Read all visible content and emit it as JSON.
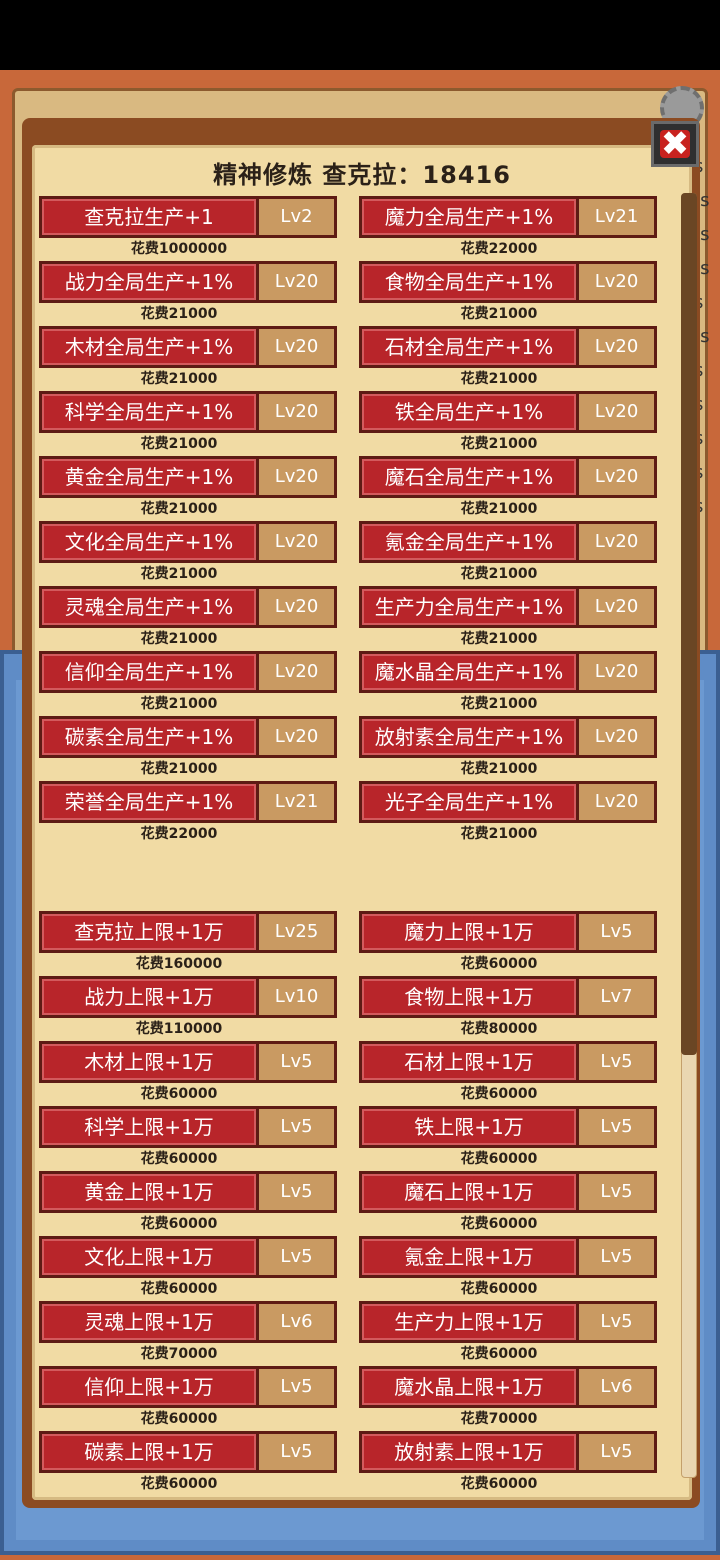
{
  "title": "精神修炼  查克拉：18416",
  "close_label": "✖",
  "side_texts": [
    "s",
    "/s",
    "/s",
    "/s",
    "s",
    "/s",
    "s",
    "s",
    "s",
    "s",
    "s"
  ],
  "global_items": [
    {
      "label": "查克拉生产+1",
      "level": "Lv2",
      "cost": "花费1000000"
    },
    {
      "label": "魔力全局生产+1%",
      "level": "Lv21",
      "cost": "花费22000"
    },
    {
      "label": "战力全局生产+1%",
      "level": "Lv20",
      "cost": "花费21000"
    },
    {
      "label": "食物全局生产+1%",
      "level": "Lv20",
      "cost": "花费21000"
    },
    {
      "label": "木材全局生产+1%",
      "level": "Lv20",
      "cost": "花费21000"
    },
    {
      "label": "石材全局生产+1%",
      "level": "Lv20",
      "cost": "花费21000"
    },
    {
      "label": "科学全局生产+1%",
      "level": "Lv20",
      "cost": "花费21000"
    },
    {
      "label": "铁全局生产+1%",
      "level": "Lv20",
      "cost": "花费21000"
    },
    {
      "label": "黄金全局生产+1%",
      "level": "Lv20",
      "cost": "花费21000"
    },
    {
      "label": "魔石全局生产+1%",
      "level": "Lv20",
      "cost": "花费21000"
    },
    {
      "label": "文化全局生产+1%",
      "level": "Lv20",
      "cost": "花费21000"
    },
    {
      "label": "氪金全局生产+1%",
      "level": "Lv20",
      "cost": "花费21000"
    },
    {
      "label": "灵魂全局生产+1%",
      "level": "Lv20",
      "cost": "花费21000"
    },
    {
      "label": "生产力全局生产+1%",
      "level": "Lv20",
      "cost": "花费21000"
    },
    {
      "label": "信仰全局生产+1%",
      "level": "Lv20",
      "cost": "花费21000"
    },
    {
      "label": "魔水晶全局生产+1%",
      "level": "Lv20",
      "cost": "花费21000"
    },
    {
      "label": "碳素全局生产+1%",
      "level": "Lv20",
      "cost": "花费21000"
    },
    {
      "label": "放射素全局生产+1%",
      "level": "Lv20",
      "cost": "花费21000"
    },
    {
      "label": "荣誉全局生产+1%",
      "level": "Lv21",
      "cost": "花费22000"
    },
    {
      "label": "光子全局生产+1%",
      "level": "Lv20",
      "cost": "花费21000"
    }
  ],
  "limit_items": [
    {
      "label": "查克拉上限+1万",
      "level": "Lv25",
      "cost": "花费160000"
    },
    {
      "label": "魔力上限+1万",
      "level": "Lv5",
      "cost": "花费60000"
    },
    {
      "label": "战力上限+1万",
      "level": "Lv10",
      "cost": "花费110000"
    },
    {
      "label": "食物上限+1万",
      "level": "Lv7",
      "cost": "花费80000"
    },
    {
      "label": "木材上限+1万",
      "level": "Lv5",
      "cost": "花费60000"
    },
    {
      "label": "石材上限+1万",
      "level": "Lv5",
      "cost": "花费60000"
    },
    {
      "label": "科学上限+1万",
      "level": "Lv5",
      "cost": "花费60000"
    },
    {
      "label": "铁上限+1万",
      "level": "Lv5",
      "cost": "花费60000"
    },
    {
      "label": "黄金上限+1万",
      "level": "Lv5",
      "cost": "花费60000"
    },
    {
      "label": "魔石上限+1万",
      "level": "Lv5",
      "cost": "花费60000"
    },
    {
      "label": "文化上限+1万",
      "level": "Lv5",
      "cost": "花费60000"
    },
    {
      "label": "氪金上限+1万",
      "level": "Lv5",
      "cost": "花费60000"
    },
    {
      "label": "灵魂上限+1万",
      "level": "Lv6",
      "cost": "花费70000"
    },
    {
      "label": "生产力上限+1万",
      "level": "Lv5",
      "cost": "花费60000"
    },
    {
      "label": "信仰上限+1万",
      "level": "Lv5",
      "cost": "花费60000"
    },
    {
      "label": "魔水晶上限+1万",
      "level": "Lv6",
      "cost": "花费70000"
    },
    {
      "label": "碳素上限+1万",
      "level": "Lv5",
      "cost": "花费60000"
    },
    {
      "label": "放射素上限+1万",
      "level": "Lv5",
      "cost": "花费60000"
    }
  ]
}
